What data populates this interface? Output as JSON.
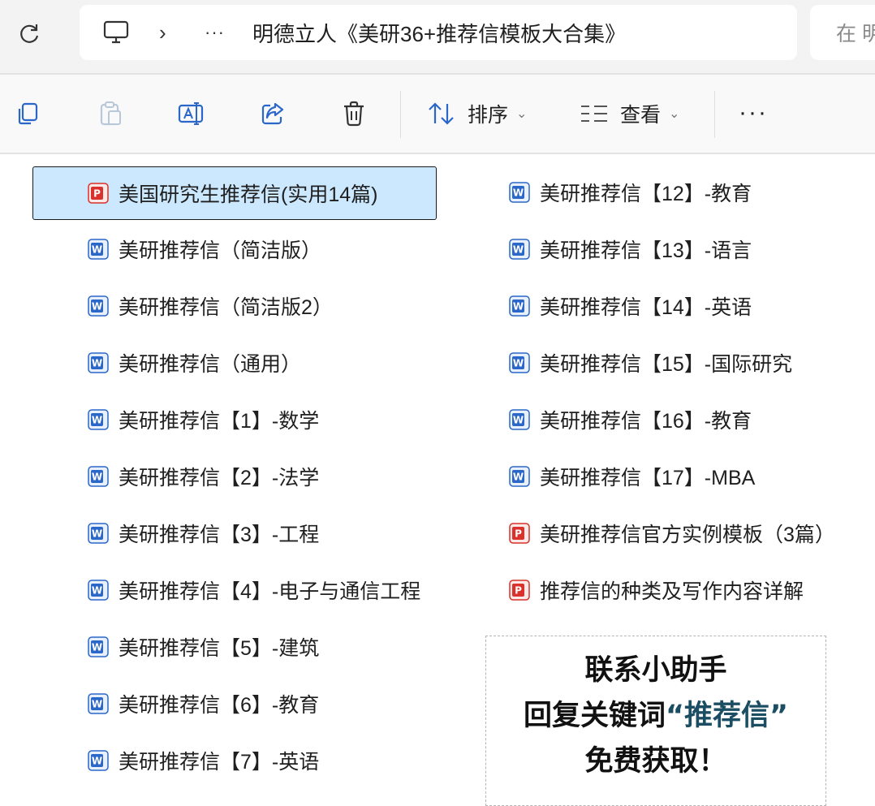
{
  "address_bar": {
    "breadcrumb_overflow": "···",
    "breadcrumb_separator": "›",
    "current_folder": "明德立人《美研36+推荐信模板大合集》",
    "search_placeholder": "在 明"
  },
  "command_bar": {
    "sort_label": "排序",
    "view_label": "查看",
    "more_label": "···"
  },
  "files": {
    "left": [
      {
        "name": "美国研究生推荐信(实用14篇)",
        "type": "pdf",
        "selected": true
      },
      {
        "name": "美研推荐信（简洁版）",
        "type": "word"
      },
      {
        "name": "美研推荐信（简洁版2）",
        "type": "word"
      },
      {
        "name": "美研推荐信（通用）",
        "type": "word"
      },
      {
        "name": "美研推荐信【1】-数学",
        "type": "word"
      },
      {
        "name": "美研推荐信【2】-法学",
        "type": "word"
      },
      {
        "name": "美研推荐信【3】-工程",
        "type": "word"
      },
      {
        "name": "美研推荐信【4】-电子与通信工程",
        "type": "word"
      },
      {
        "name": "美研推荐信【5】-建筑",
        "type": "word"
      },
      {
        "name": "美研推荐信【6】-教育",
        "type": "word"
      },
      {
        "name": "美研推荐信【7】-英语",
        "type": "word"
      }
    ],
    "right": [
      {
        "name": "美研推荐信【12】-教育",
        "type": "word"
      },
      {
        "name": "美研推荐信【13】-语言",
        "type": "word"
      },
      {
        "name": "美研推荐信【14】-英语",
        "type": "word"
      },
      {
        "name": "美研推荐信【15】-国际研究",
        "type": "word"
      },
      {
        "name": "美研推荐信【16】-教育",
        "type": "word"
      },
      {
        "name": "美研推荐信【17】-MBA",
        "type": "word"
      },
      {
        "name": "美研推荐信官方实例模板（3篇）",
        "type": "pdf"
      },
      {
        "name": "推荐信的种类及写作内容详解",
        "type": "pdf"
      }
    ]
  },
  "promo": {
    "line1": "联系小助手",
    "line2_prefix": "回复关键词",
    "line2_keyword": "“推荐信”",
    "line3": "免费获取！"
  },
  "colors": {
    "selection_bg": "#cce8ff",
    "word_icon": "#2b67c9",
    "pdf_icon": "#d9312b",
    "keyword": "#1c4e63"
  }
}
